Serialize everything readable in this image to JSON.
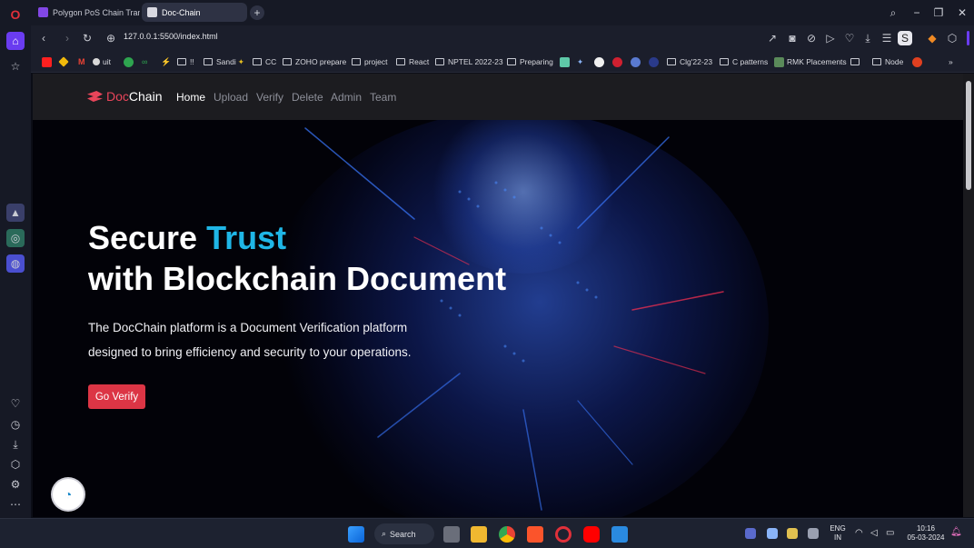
{
  "browser": {
    "tabs": [
      {
        "label": "Polygon PoS Chain Transa",
        "active": false
      },
      {
        "label": "Doc-Chain",
        "active": true
      }
    ],
    "url": "127.0.0.1:5500/index.html",
    "bookmarks": [
      "uit",
      "!!",
      "Sandi",
      "CC",
      "ZOHO prepare",
      "project",
      "React",
      "NPTEL 2022-23",
      "Preparing",
      "Clg'22-23",
      "C patterns",
      "RMK Placements",
      "Node"
    ]
  },
  "site": {
    "brand_prefix": "Doc",
    "brand_suffix": "Chain",
    "nav": [
      "Home",
      "Upload",
      "Verify",
      "Delete",
      "Admin",
      "Team"
    ],
    "hero": {
      "line1_a": "Secure ",
      "line1_b": "Trust",
      "line2": "with Blockchain Document",
      "desc1": "The DocChain platform is a Document Verification platform",
      "desc2": "designed to bring efficiency and security to your operations.",
      "cta": "Go Verify"
    }
  },
  "taskbar": {
    "search": "Search",
    "lang1": "ENG",
    "lang2": "IN",
    "time": "10:16",
    "date": "05-03-2024"
  },
  "colors": {
    "accent_red": "#dc3545",
    "accent_cyan": "#1fb6e6",
    "brand_red": "#e8455a"
  }
}
